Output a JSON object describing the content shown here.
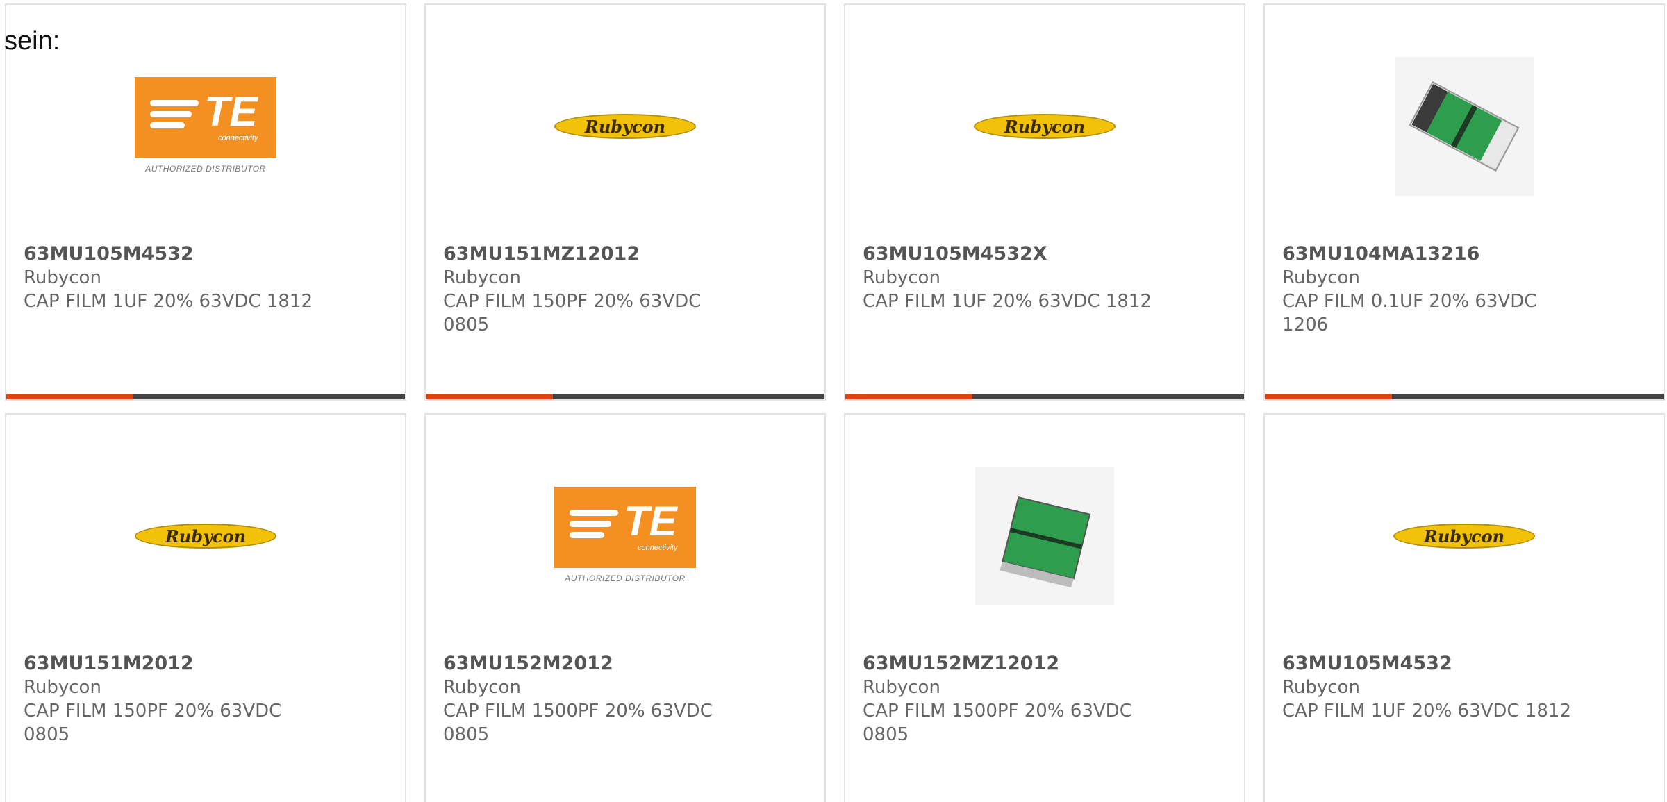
{
  "lead_text": "sein:",
  "colors": {
    "accent": "#e8400c",
    "bar": "#444444",
    "te_orange": "#f39021",
    "rubycon_yellow": "#f2c20a",
    "chip_green": "#2e9e4e"
  },
  "logos": {
    "te_letters": "TE",
    "te_sub": "connectivity",
    "te_dist": "AUTHORIZED DISTRIBUTOR",
    "rubycon_text": "Rubycon"
  },
  "products": [
    {
      "part": "63MU105M4532",
      "maker": "Rubycon",
      "desc": "CAP FILM 1UF 20% 63VDC 1812",
      "image": "te-logo"
    },
    {
      "part": "63MU151MZ12012",
      "maker": "Rubycon",
      "desc": "CAP FILM 150PF 20% 63VDC 0805",
      "image": "rubycon-logo"
    },
    {
      "part": "63MU105M4532X",
      "maker": "Rubycon",
      "desc": "CAP FILM 1UF 20% 63VDC 1812",
      "image": "rubycon-logo"
    },
    {
      "part": "63MU104MA13216",
      "maker": "Rubycon",
      "desc": "CAP FILM 0.1UF 20% 63VDC 1206",
      "image": "chip-photo-angled"
    },
    {
      "part": "63MU151M2012",
      "maker": "Rubycon",
      "desc": "CAP FILM 150PF 20% 63VDC 0805",
      "image": "rubycon-logo"
    },
    {
      "part": "63MU152M2012",
      "maker": "Rubycon",
      "desc": "CAP FILM 1500PF 20% 63VDC 0805",
      "image": "te-logo"
    },
    {
      "part": "63MU152MZ12012",
      "maker": "Rubycon",
      "desc": "CAP FILM 1500PF 20% 63VDC 0805",
      "image": "chip-photo-square"
    },
    {
      "part": "63MU105M4532",
      "maker": "Rubycon",
      "desc": "CAP FILM 1UF 20% 63VDC 1812",
      "image": "rubycon-logo"
    }
  ]
}
